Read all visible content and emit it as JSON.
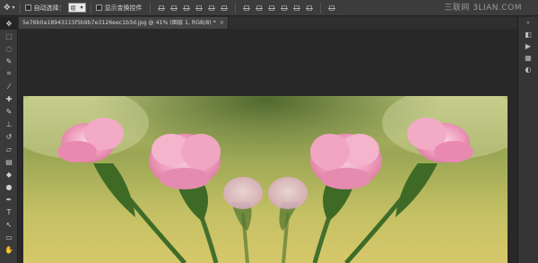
{
  "optionsBar": {
    "autoSelectLabel": "自动选择：",
    "autoSelectValue": "组",
    "showTransformLabel": "显示变换控件"
  },
  "watermark": "三联网 3LIAN.COM",
  "document": {
    "tabTitle": "5e76b0a18943115f5b9b7e3126eec1b3d.jpg @ 41% (图层 1, RGB/8) *",
    "closeGlyph": "×"
  },
  "icons": {
    "move": "✥",
    "artboard": "⬚",
    "marquee": "⬚",
    "lasso": "◌",
    "quickSelect": "✎",
    "crop": "⌗",
    "eyedropper": "⁄",
    "healing": "✚",
    "brush": "✎",
    "stamp": "⊥",
    "history": "↺",
    "eraser": "▱",
    "gradient": "▤",
    "blur": "◆",
    "dodge": "●",
    "pen": "✒",
    "type": "T",
    "path": "↖",
    "shape": "▭",
    "hand": "✋",
    "zoom": "⚲",
    "dock1": "◧",
    "dock2": "▶",
    "dock3": "▦",
    "dock4": "◐"
  }
}
